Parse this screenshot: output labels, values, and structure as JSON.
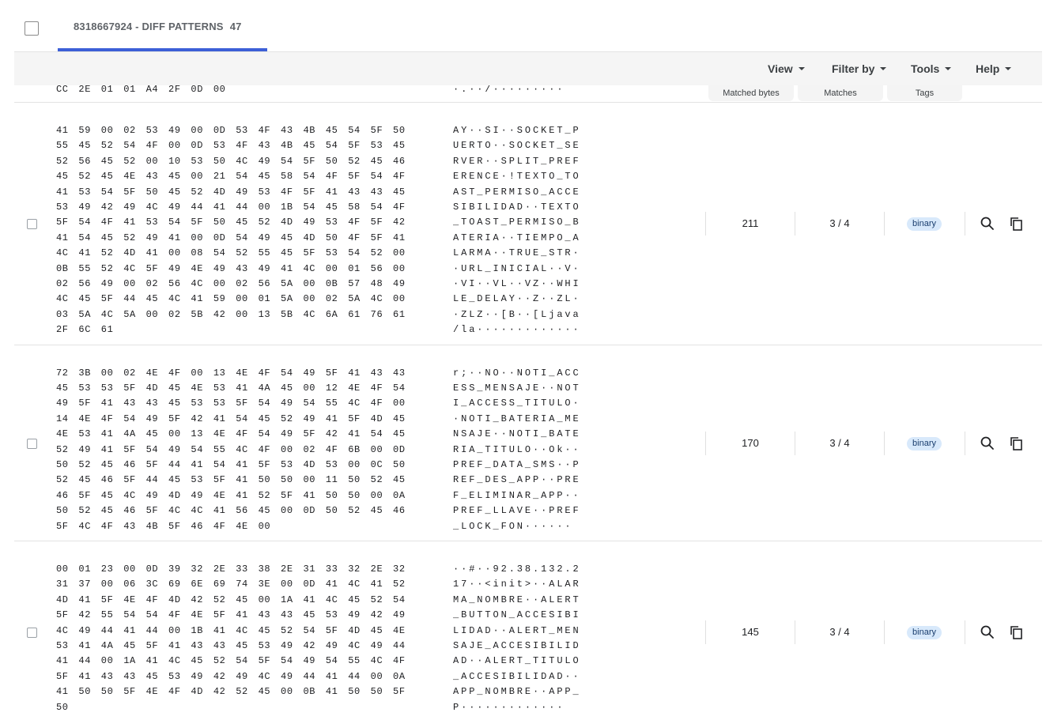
{
  "tab": {
    "title": "8318667924 - DIFF PATTERNS",
    "count": "47"
  },
  "toolbar": {
    "view": "View",
    "filter": "Filter by",
    "tools": "Tools",
    "help": "Help"
  },
  "columns": {
    "matched_bytes": "Matched bytes",
    "matches": "Matches",
    "tags": "Tags"
  },
  "partial_row": {
    "hex": "CC 2E 01 01 A4 2F 0D 00",
    "ascii": "·.··/·········"
  },
  "records": [
    {
      "hex": [
        "41 59 00 02 53 49 00 0D 53 4F 43 4B 45 54 5F 50",
        "55 45 52 54 4F 00 0D 53 4F 43 4B 45 54 5F 53 45",
        "52 56 45 52 00 10 53 50 4C 49 54 5F 50 52 45 46",
        "45 52 45 4E 43 45 00 21 54 45 58 54 4F 5F 54 4F",
        "41 53 54 5F 50 45 52 4D 49 53 4F 5F 41 43 43 45",
        "53 49 42 49 4C 49 44 41 44 00 1B 54 45 58 54 4F",
        "5F 54 4F 41 53 54 5F 50 45 52 4D 49 53 4F 5F 42",
        "41 54 45 52 49 41 00 0D 54 49 45 4D 50 4F 5F 41",
        "4C 41 52 4D 41 00 08 54 52 55 45 5F 53 54 52 00",
        "0B 55 52 4C 5F 49 4E 49 43 49 41 4C 00 01 56 00",
        "02 56 49 00 02 56 4C 00 02 56 5A 00 0B 57 48 49",
        "4C 45 5F 44 45 4C 41 59 00 01 5A 00 02 5A 4C 00",
        "03 5A 4C 5A 00 02 5B 42 00 13 5B 4C 6A 61 76 61",
        "2F 6C 61"
      ],
      "ascii": [
        "AY··SI··SOCKET_P",
        "UERTO··SOCKET_SE",
        "RVER··SPLIT_PREF",
        "ERENCE·!TEXTO_TO",
        "AST_PERMISO_ACCE",
        "SIBILIDAD··TEXTO",
        "_TOAST_PERMISO_B",
        "ATERIA··TIEMPO_A",
        "LARMA··TRUE_STR·",
        "·URL_INICIAL··V·",
        "·VI··VL··VZ··WHI",
        "LE_DELAY··Z··ZL·",
        "·ZLZ··[B··[Ljava",
        "/la·············"
      ],
      "matched_bytes": "211",
      "matches": "3 / 4",
      "tag": "binary"
    },
    {
      "hex": [
        "72 3B 00 02 4E 4F 00 13 4E 4F 54 49 5F 41 43 43",
        "45 53 53 5F 4D 45 4E 53 41 4A 45 00 12 4E 4F 54",
        "49 5F 41 43 43 45 53 53 5F 54 49 54 55 4C 4F 00",
        "14 4E 4F 54 49 5F 42 41 54 45 52 49 41 5F 4D 45",
        "4E 53 41 4A 45 00 13 4E 4F 54 49 5F 42 41 54 45",
        "52 49 41 5F 54 49 54 55 4C 4F 00 02 4F 6B 00 0D",
        "50 52 45 46 5F 44 41 54 41 5F 53 4D 53 00 0C 50",
        "52 45 46 5F 44 45 53 5F 41 50 50 00 11 50 52 45",
        "46 5F 45 4C 49 4D 49 4E 41 52 5F 41 50 50 00 0A",
        "50 52 45 46 5F 4C 4C 41 56 45 00 0D 50 52 45 46",
        "5F 4C 4F 43 4B 5F 46 4F 4E 00"
      ],
      "ascii": [
        "r;··NO··NOTI_ACC",
        "ESS_MENSAJE··NOT",
        "I_ACCESS_TITULO·",
        "·NOTI_BATERIA_ME",
        "NSAJE··NOTI_BATE",
        "RIA_TITULO··Ok··",
        "PREF_DATA_SMS··P",
        "REF_DES_APP··PRE",
        "F_ELIMINAR_APP··",
        "PREF_LLAVE··PREF",
        "_LOCK_FON······"
      ],
      "matched_bytes": "170",
      "matches": "3 / 4",
      "tag": "binary"
    },
    {
      "hex": [
        "00 01 23 00 0D 39 32 2E 33 38 2E 31 33 32 2E 32",
        "31 37 00 06 3C 69 6E 69 74 3E 00 0D 41 4C 41 52",
        "4D 41 5F 4E 4F 4D 42 52 45 00 1A 41 4C 45 52 54",
        "5F 42 55 54 54 4F 4E 5F 41 43 43 45 53 49 42 49",
        "4C 49 44 41 44 00 1B 41 4C 45 52 54 5F 4D 45 4E",
        "53 41 4A 45 5F 41 43 43 45 53 49 42 49 4C 49 44",
        "41 44 00 1A 41 4C 45 52 54 5F 54 49 54 55 4C 4F",
        "5F 41 43 43 45 53 49 42 49 4C 49 44 41 44 00 0A",
        "41 50 50 5F 4E 4F 4D 42 52 45 00 0B 41 50 50 5F",
        "50"
      ],
      "ascii": [
        "··#··92.38.132.2",
        "17··<init>··ALAR",
        "MA_NOMBRE··ALERT",
        "_BUTTON_ACCESIBI",
        "LIDAD··ALERT_MEN",
        "SAJE_ACCESIBILID",
        "AD··ALERT_TITULO",
        "_ACCESIBILIDAD··",
        "APP_NOMBRE··APP_",
        "P·············"
      ],
      "matched_bytes": "145",
      "matches": "3 / 4",
      "tag": "binary"
    }
  ],
  "icons": {
    "search": "search-icon",
    "copy": "copy-icon"
  }
}
